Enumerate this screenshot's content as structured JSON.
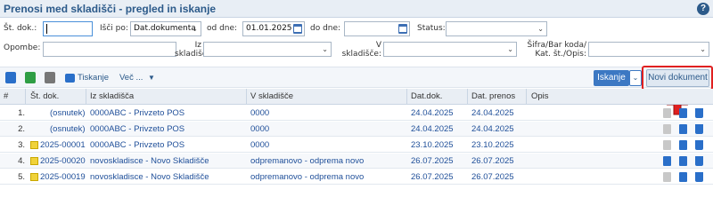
{
  "window": {
    "title": "Prenosi med skladišči - pregled in iskanje",
    "help_label": "?"
  },
  "filters": {
    "st_dok_label": "Št. dok.:",
    "st_dok_value": "",
    "isci_po_label": "Išči po:",
    "isci_po_value": "Dat.dokumenta",
    "od_dne_label": "od dne:",
    "od_dne_value": "01.01.2025",
    "do_dne_label": "do dne:",
    "do_dne_value": "",
    "status_label": "Status:",
    "status_value": "",
    "opombe_label": "Opombe:",
    "opombe_value": "",
    "iz_skladisca_label_1": "Iz",
    "iz_skladisca_label_2": "skladišča:",
    "iz_skladisca_value": "",
    "v_skladisce_label_1": "V",
    "v_skladisce_label_2": "skladišče:",
    "v_skladisce_value": "",
    "sifra_label_1": "Šifra/Bar koda/",
    "sifra_label_2": "Kat. št./Opis:",
    "sifra_value": ""
  },
  "toolbar": {
    "tiskanje_label": "Tiskanje",
    "vec_label": "Več ...",
    "vec_caret": "▼",
    "iskanje_label": "Iskanje",
    "iskanje_caret": "⌄",
    "novi_dokument_label": "Novi dokument"
  },
  "table": {
    "headers": [
      "#",
      "Št. dok.",
      "Iz skladišča",
      "V skladišče",
      "Dat.dok.",
      "Dat. prenos",
      "Opis"
    ],
    "rows": [
      {
        "n": "1.",
        "st_dok": "(osnutek)",
        "iz": "0000ABC - Privzeto POS",
        "v": "0000",
        "dat_dok": "24.04.2025",
        "dat_prenos": "24.04.2025",
        "opis": "",
        "flag": false
      },
      {
        "n": "2.",
        "st_dok": "(osnutek)",
        "iz": "0000ABC - Privzeto POS",
        "v": "0000",
        "dat_dok": "24.04.2025",
        "dat_prenos": "24.04.2025",
        "opis": "",
        "flag": false
      },
      {
        "n": "3.",
        "st_dok": "2025-00001",
        "iz": "0000ABC - Privzeto POS",
        "v": "0000",
        "dat_dok": "23.10.2025",
        "dat_prenos": "23.10.2025",
        "opis": "",
        "flag": true
      },
      {
        "n": "4.",
        "st_dok": "2025-00020",
        "iz": "novoskladisce - Novo Skladišče",
        "v": "odpremanovo - odprema novo",
        "dat_dok": "26.07.2025",
        "dat_prenos": "26.07.2025",
        "opis": "",
        "flag": true
      },
      {
        "n": "5.",
        "st_dok": "2025-00019",
        "iz": "novoskladisce - Novo Skladišče",
        "v": "odpremanovo - odprema novo",
        "dat_dok": "26.07.2025",
        "dat_prenos": "26.07.2025",
        "opis": "",
        "flag": true
      }
    ]
  },
  "colors": {
    "accent": "#2c5a8a",
    "link": "#1f4f99",
    "button_blue": "#3c78c3",
    "highlight_red": "#e02020",
    "draft_flag": "#f0d23a"
  }
}
